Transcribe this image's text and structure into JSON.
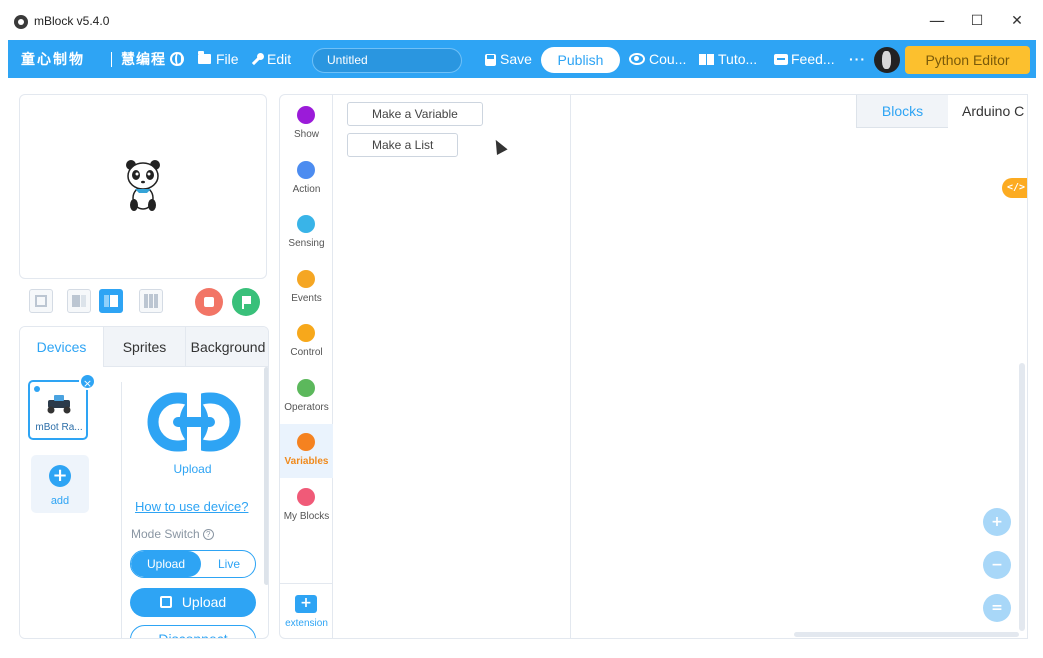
{
  "window": {
    "title": "mBlock v5.4.0",
    "minimize": "—",
    "maximize": "☐",
    "close": "✕"
  },
  "menubar": {
    "brand_cn": "童心制物",
    "brand_cn2": "慧编程",
    "file": "File",
    "edit": "Edit",
    "project_title": "Untitled",
    "save": "Save",
    "publish": "Publish",
    "courses": "Cou...",
    "tutorials": "Tuto...",
    "feedback": "Feed...",
    "more": "···",
    "python_editor": "Python Editor"
  },
  "stage_panel": {
    "tabs": [
      "Devices",
      "Sprites",
      "Background"
    ]
  },
  "devices": {
    "device_name": "mBot Ra...",
    "remove": "×",
    "add_symbol": "+",
    "add_label": "add",
    "upload_caption": "Upload",
    "how_to": "How to use device?",
    "mode_switch": "Mode Switch",
    "mode_help": "?",
    "mode_upload": "Upload",
    "mode_live": "Live",
    "upload_button": "Upload",
    "disconnect_button": "Disconnect"
  },
  "categories": [
    {
      "label": "Show",
      "color": "#9b1bd9"
    },
    {
      "label": "Action",
      "color": "#4c8cf0"
    },
    {
      "label": "Sensing",
      "color": "#39b4e8"
    },
    {
      "label": "Events",
      "color": "#f5a623"
    },
    {
      "label": "Control",
      "color": "#f7a81b"
    },
    {
      "label": "Operators",
      "color": "#5cb85c"
    },
    {
      "label": "Variables",
      "color": "#f58220"
    },
    {
      "label": "My Blocks",
      "color": "#f05a78"
    }
  ],
  "extension": {
    "label": "extension",
    "symbol": "+"
  },
  "palette": {
    "make_variable": "Make a Variable",
    "make_list": "Make a List"
  },
  "code_area": {
    "tab_blocks": "Blocks",
    "tab_arduino": "Arduino C",
    "code_toggle": "</>",
    "zoom_in": "+",
    "zoom_out": "−",
    "zoom_reset": "="
  },
  "colors": {
    "accent": "#2ea4f4",
    "python_button": "#fcc02e",
    "stop_button": "#f27566",
    "go_button": "#39c07a"
  }
}
